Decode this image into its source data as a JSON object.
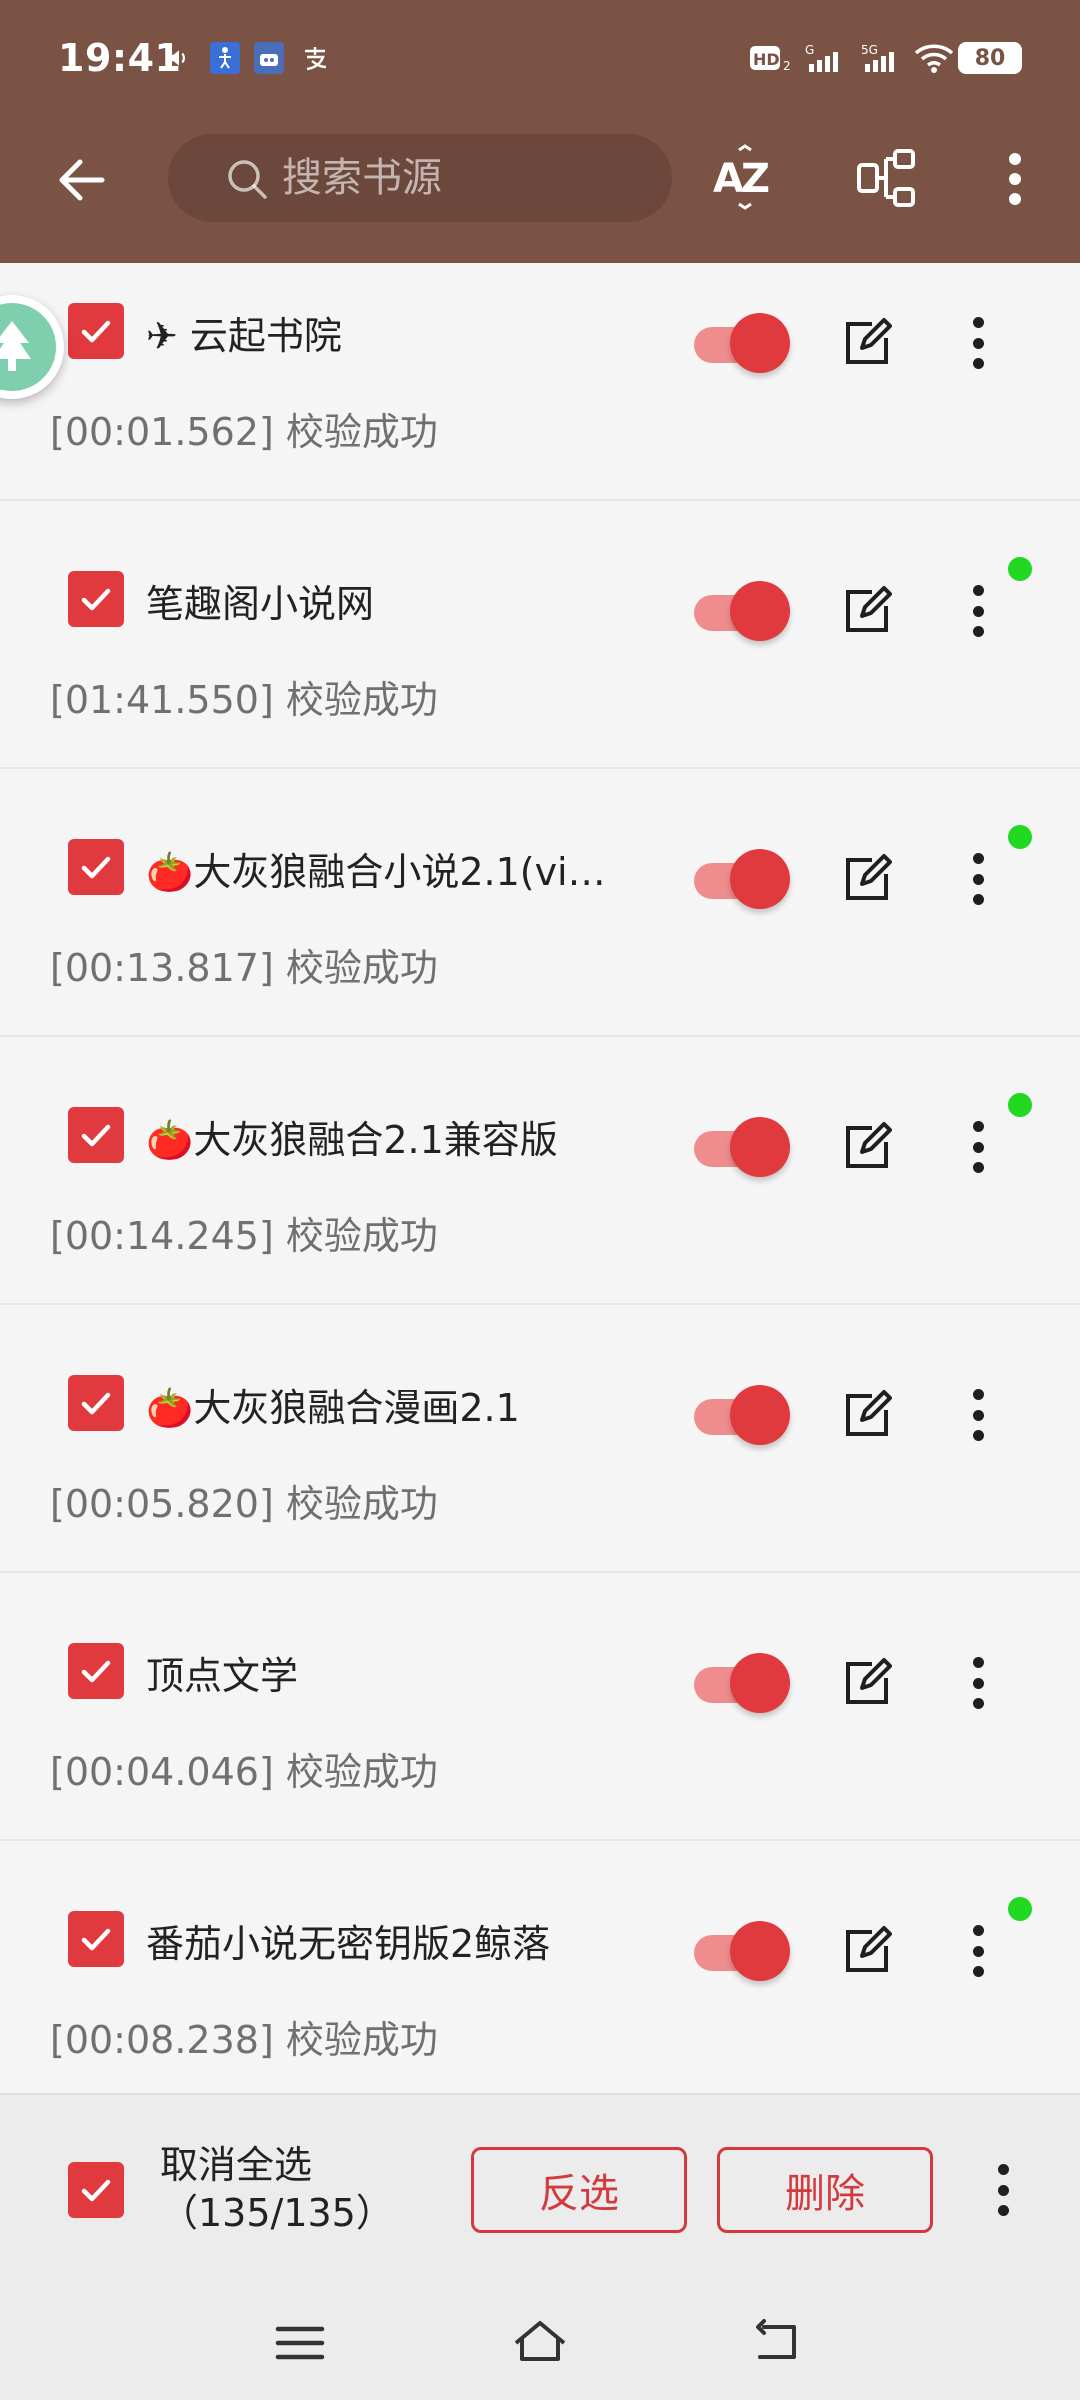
{
  "status_bar": {
    "time": "19:41",
    "icons": [
      "volume-icon",
      "accessibility-icon",
      "app-icon",
      "alipay-icon",
      "hd-icon",
      "signal-icon",
      "5g-signal-icon",
      "wifi-icon"
    ],
    "battery": "80"
  },
  "toolbar": {
    "search_placeholder": "搜索书源",
    "sort_icon": "az-sort-icon",
    "group_icon": "group-icon"
  },
  "sources": [
    {
      "name": "✈ 云起书院",
      "status": "[00:01.562] 校验成功",
      "enabled": true,
      "checked": true,
      "new_dot": false
    },
    {
      "name": "笔趣阁小说网",
      "status": "[01:41.550] 校验成功",
      "enabled": true,
      "checked": true,
      "new_dot": true
    },
    {
      "name": "🍅大灰狼融合小说2.1(vi…",
      "status": "[00:13.817] 校验成功",
      "enabled": true,
      "checked": true,
      "new_dot": true
    },
    {
      "name": "🍅大灰狼融合2.1兼容版",
      "status": "[00:14.245] 校验成功",
      "enabled": true,
      "checked": true,
      "new_dot": true
    },
    {
      "name": "🍅大灰狼融合漫画2.1",
      "status": "[00:05.820] 校验成功",
      "enabled": true,
      "checked": true,
      "new_dot": false
    },
    {
      "name": "顶点文学",
      "status": "[00:04.046] 校验成功",
      "enabled": true,
      "checked": true,
      "new_dot": false
    },
    {
      "name": "番茄小说无密钥版2鲸落",
      "status": "[00:08.238] 校验成功",
      "enabled": true,
      "checked": true,
      "new_dot": true
    }
  ],
  "action_bar": {
    "select_label": "取消全选",
    "count": "（135/135）",
    "invert_label": "反选",
    "delete_label": "删除"
  },
  "colors": {
    "appbar": "#7a5344",
    "accent": "#e0393e",
    "switch_track": "#ef8c8d",
    "new_dot": "#22d922"
  }
}
